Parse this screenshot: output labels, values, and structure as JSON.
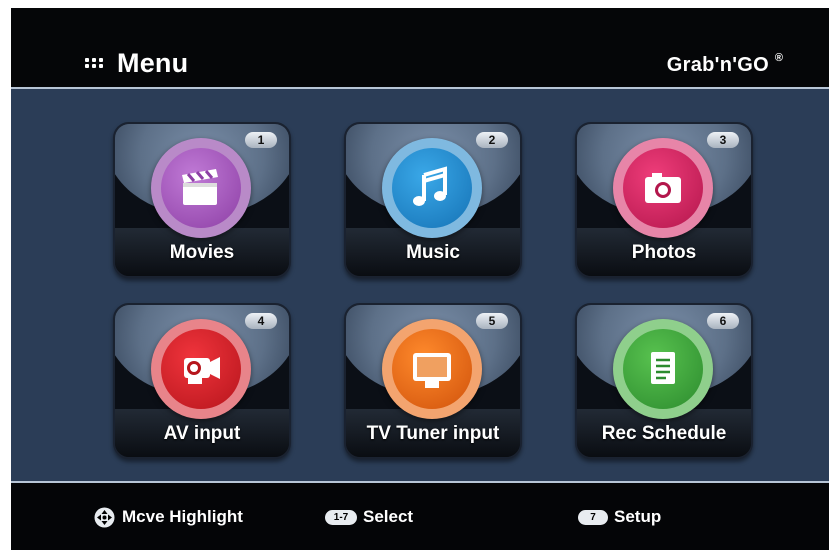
{
  "header": {
    "title": "Menu",
    "menu_icon": "grid-dots-icon",
    "brand": "Grab'n'GO",
    "brand_mark": "®"
  },
  "tiles": [
    {
      "label": "Movies",
      "number": "1",
      "icon": "clapperboard-icon",
      "color": "#9b4fb0"
    },
    {
      "label": "Music",
      "number": "2",
      "icon": "music-note-icon",
      "color": "#1e86c8"
    },
    {
      "label": "Photos",
      "number": "3",
      "icon": "camera-icon",
      "color": "#d11e5d"
    },
    {
      "label": "AV input",
      "number": "4",
      "icon": "camcorder-icon",
      "color": "#d8232a"
    },
    {
      "label": "TV Tuner input",
      "number": "5",
      "icon": "tv-icon",
      "color": "#f06a16"
    },
    {
      "label": "Rec Schedule",
      "number": "6",
      "icon": "schedule-document-icon",
      "color": "#3aa43a"
    }
  ],
  "footer": {
    "move": {
      "label": "Mcve Highlight",
      "icon": "dpad-icon"
    },
    "select": {
      "label": "Select",
      "key": "1-7"
    },
    "setup": {
      "label": "Setup",
      "key": "7"
    }
  }
}
